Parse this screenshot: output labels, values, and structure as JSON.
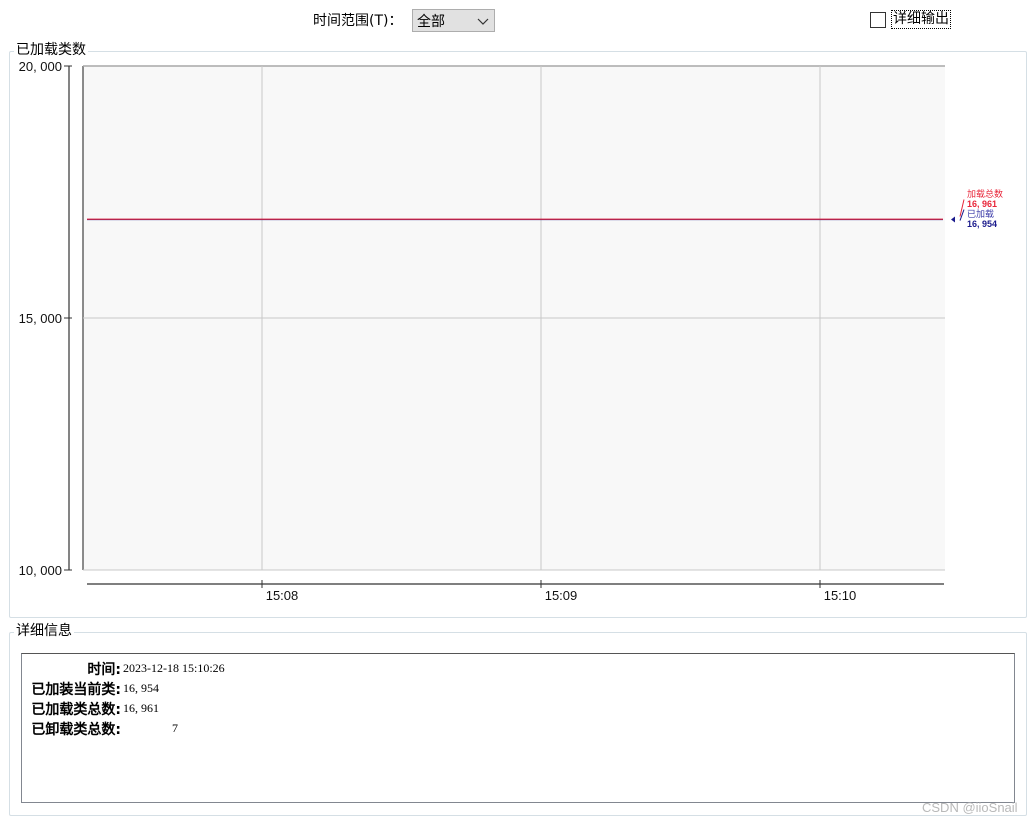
{
  "toolbar": {
    "time_range_label": "时间范围(T)：",
    "time_range_value": "全部",
    "detail_output_label": "详细输出",
    "detail_output_checked": false
  },
  "chart_panel": {
    "title": "已加载类数"
  },
  "chart_data": {
    "type": "line",
    "title": "",
    "xlabel": "",
    "ylabel": "",
    "ylim": [
      10000,
      20000
    ],
    "yticks": [
      "20, 000",
      "15, 000",
      "10, 000"
    ],
    "ytick_values": [
      20000,
      15000,
      10000
    ],
    "xticks": [
      "15:08",
      "15:09",
      "15:10"
    ],
    "grid": true,
    "legend_position": "right",
    "series": [
      {
        "name": "加载总数",
        "value_label": "16, 961",
        "color": "#e8263a",
        "x": [
          "15:07:23",
          "15:10:26"
        ],
        "values": [
          16961,
          16961
        ]
      },
      {
        "name": "已加载",
        "value_label": "16, 954",
        "color": "#1a1a8c",
        "x": [
          "15:07:23",
          "15:10:26"
        ],
        "values": [
          16954,
          16954
        ]
      }
    ]
  },
  "details_panel": {
    "title": "详细信息",
    "rows": [
      {
        "label": "时间:",
        "value": "2023-12-18 15:10:26"
      },
      {
        "label": "已加装当前类:",
        "value": "16, 954"
      },
      {
        "label": "已加载类总数:",
        "value": "16, 961"
      },
      {
        "label": "已卸载类总数:",
        "value": "7"
      }
    ]
  },
  "watermark": "CSDN @iioSnail"
}
